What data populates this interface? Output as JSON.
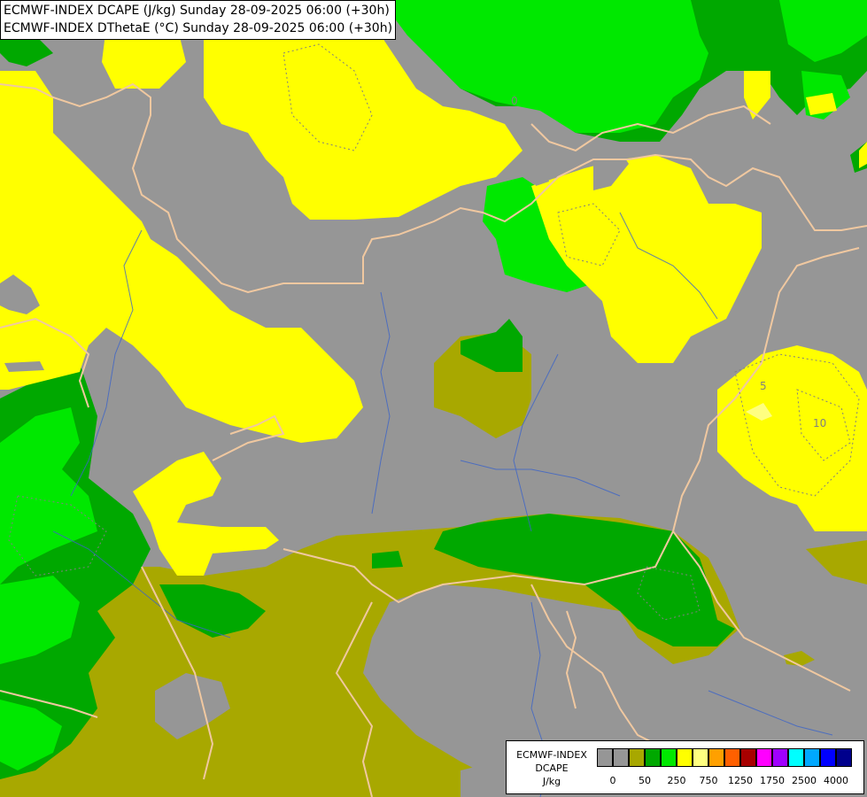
{
  "title": {
    "line1": "ECMWF-INDEX DCAPE (J/kg) Sunday 28-09-2025 06:00 (+30h)",
    "line2": "ECMWF-INDEX DThetaE (°C) Sunday 28-09-2025 06:00 (+30h)"
  },
  "legend": {
    "model": "ECMWF-INDEX",
    "parameter": "DCAPE",
    "unit": "J/kg",
    "tick_labels": [
      "0",
      "50",
      "250",
      "750",
      "1250",
      "1750",
      "2500",
      "4000"
    ],
    "colors": [
      "#969696",
      "#969696",
      "#a8a800",
      "#00a800",
      "#00e800",
      "#ffff00",
      "#ffff80",
      "#ffa000",
      "#ff6000",
      "#a80000",
      "#ff00ff",
      "#a000ff",
      "#00ffff",
      "#00a8ff",
      "#0000ff",
      "#00008c"
    ]
  },
  "contour_labels": [
    "5",
    "10",
    "0"
  ],
  "map_colors": {
    "background": "#969696",
    "olive": "#a8a800",
    "dark_green": "#00a800",
    "bright_green": "#00e800",
    "yellow": "#ffff00",
    "light_yellow": "#ffff80",
    "border": "#f0c8a0",
    "river": "#3c64c8"
  }
}
